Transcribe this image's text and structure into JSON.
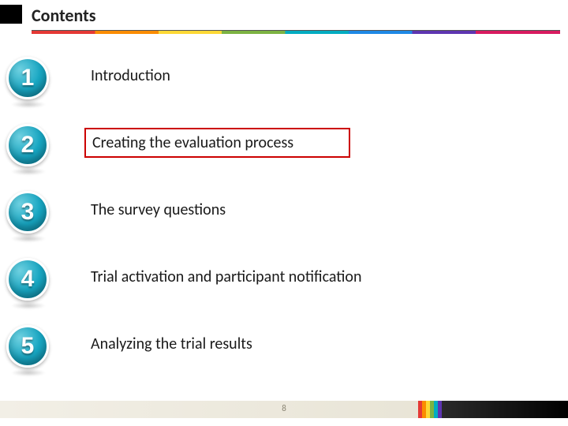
{
  "header": {
    "title": "Contents"
  },
  "items": [
    {
      "num": "1",
      "label": "Introduction",
      "current": false
    },
    {
      "num": "2",
      "label": "Creating the evaluation process",
      "current": true
    },
    {
      "num": "3",
      "label": "The survey questions",
      "current": false
    },
    {
      "num": "4",
      "label": "Trial activation and participant notification",
      "current": false
    },
    {
      "num": "5",
      "label": "Analyzing the trial results",
      "current": false
    }
  ],
  "footer": {
    "page": "8"
  }
}
